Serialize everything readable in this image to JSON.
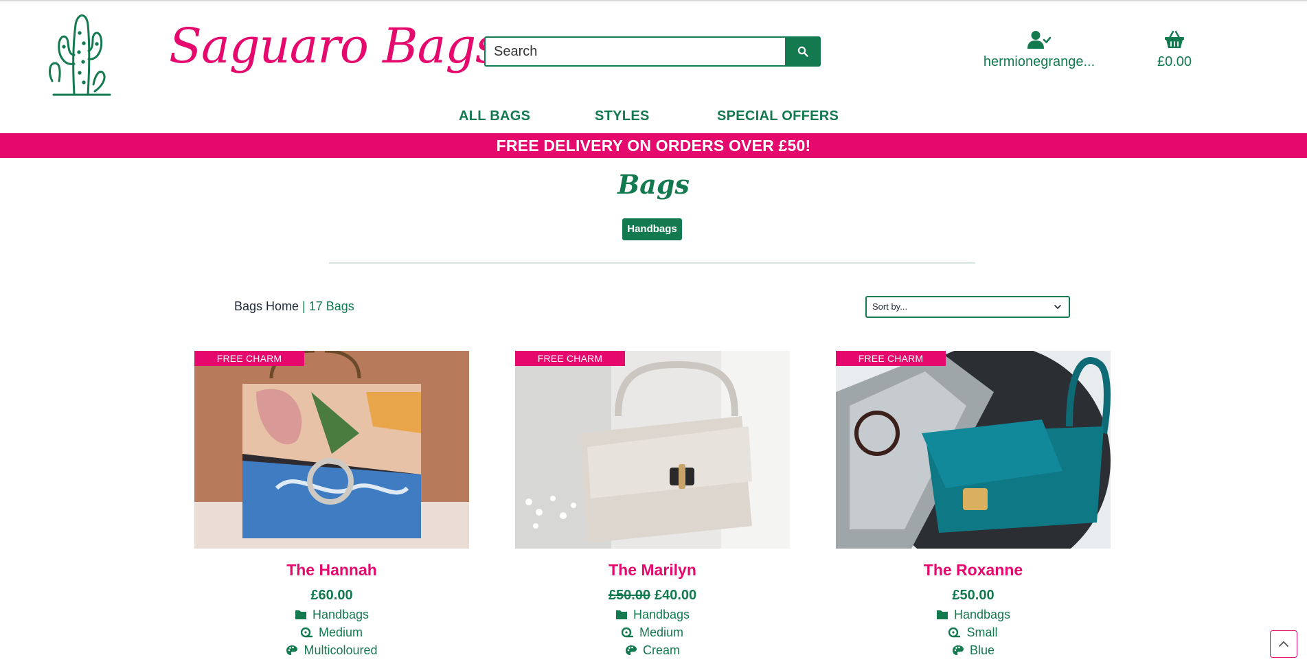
{
  "brand": {
    "name": "Saguaro Bags",
    "accent": "#e5096e",
    "primary": "#13794f"
  },
  "search": {
    "placeholder": "Search",
    "button_icon": "search-icon"
  },
  "account": {
    "label": "hermionegrange...",
    "icon": "user-check-icon"
  },
  "bag": {
    "total": "£0.00",
    "icon": "shopping-basket-icon"
  },
  "nav": {
    "items": [
      "ALL BAGS",
      "STYLES",
      "SPECIAL OFFERS"
    ]
  },
  "banner": {
    "text": "FREE DELIVERY ON ORDERS OVER £50!"
  },
  "page": {
    "title": "Bags",
    "category_chip": "Handbags"
  },
  "breadcrumb": {
    "home": "Bags Home",
    "separator": " | ",
    "count": "17 Bags"
  },
  "sort": {
    "selected": "Sort by..."
  },
  "products": [
    {
      "name": "The Hannah",
      "ribbon": "FREE CHARM",
      "old_price": "",
      "price": "£60.00",
      "category": "Handbags",
      "size": "Medium",
      "colour": "Multicoloured"
    },
    {
      "name": "The Marilyn",
      "ribbon": "FREE CHARM",
      "old_price": "£50.00",
      "price": "£40.00",
      "category": "Handbags",
      "size": "Medium",
      "colour": "Cream"
    },
    {
      "name": "The Roxanne",
      "ribbon": "FREE CHARM",
      "old_price": "",
      "price": "£50.00",
      "category": "Handbags",
      "size": "Small",
      "colour": "Blue"
    }
  ],
  "back_to_top": {
    "icon": "chevron-up-icon"
  }
}
